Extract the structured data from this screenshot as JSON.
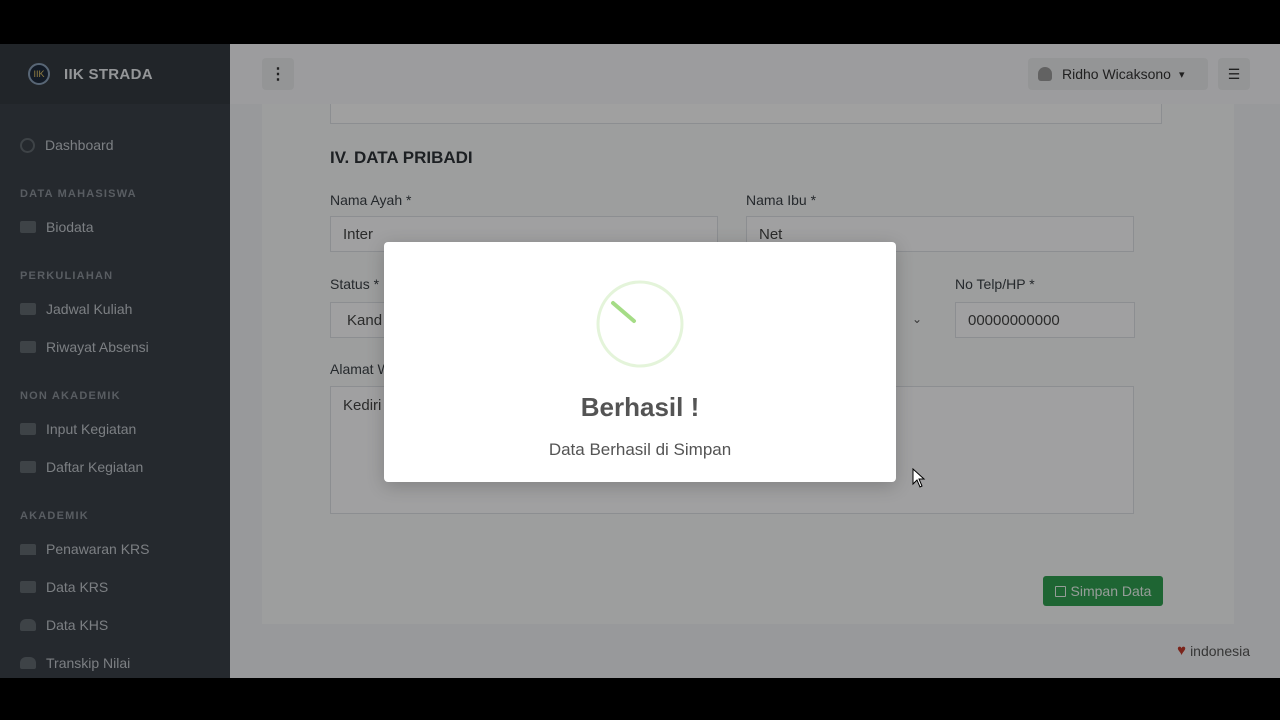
{
  "brand": {
    "name": "IIK STRADA",
    "logo_text": "IIK"
  },
  "sidebar": {
    "items": [
      {
        "type": "item",
        "label": "Dashboard",
        "icon": "dashboard-icon"
      },
      {
        "type": "head",
        "label": "DATA MAHASISWA"
      },
      {
        "type": "item",
        "label": "Biodata",
        "icon": "folder-icon"
      },
      {
        "type": "head",
        "label": "PERKULIAHAN"
      },
      {
        "type": "item",
        "label": "Jadwal Kuliah",
        "icon": "folder-icon"
      },
      {
        "type": "item",
        "label": "Riwayat Absensi",
        "icon": "folder-icon"
      },
      {
        "type": "head",
        "label": "NON AKADEMIK"
      },
      {
        "type": "item",
        "label": "Input Kegiatan",
        "icon": "folder-icon"
      },
      {
        "type": "item",
        "label": "Daftar Kegiatan",
        "icon": "folder-icon"
      },
      {
        "type": "head",
        "label": "AKADEMIK"
      },
      {
        "type": "item",
        "label": "Penawaran KRS",
        "icon": "book-icon"
      },
      {
        "type": "item",
        "label": "Data KRS",
        "icon": "folder-icon"
      },
      {
        "type": "item",
        "label": "Data KHS",
        "icon": "hand-icon"
      },
      {
        "type": "item",
        "label": "Transkip Nilai",
        "icon": "hand-icon"
      }
    ]
  },
  "topbar": {
    "menu_icon": "⋮",
    "user_name": "Ridho Wicaksono",
    "list_icon": "☰"
  },
  "form": {
    "section_title": "IV. DATA PRIBADI",
    "nama_ayah_label": "Nama Ayah *",
    "nama_ayah_value": "Inter",
    "nama_ibu_label": "Nama Ibu *",
    "nama_ibu_value": "Net",
    "status_label": "Status *",
    "status_value": "Kand",
    "telp_label": "No Telp/HP *",
    "telp_value": "00000000000",
    "alamat_label": "Alamat W",
    "alamat_value": "Kediri",
    "save_label": "Simpan Data"
  },
  "footer": {
    "text": "indonesia"
  },
  "modal": {
    "title": "Berhasil !",
    "text": "Data Berhasil di Simpan",
    "accent": "#a5dc86"
  }
}
